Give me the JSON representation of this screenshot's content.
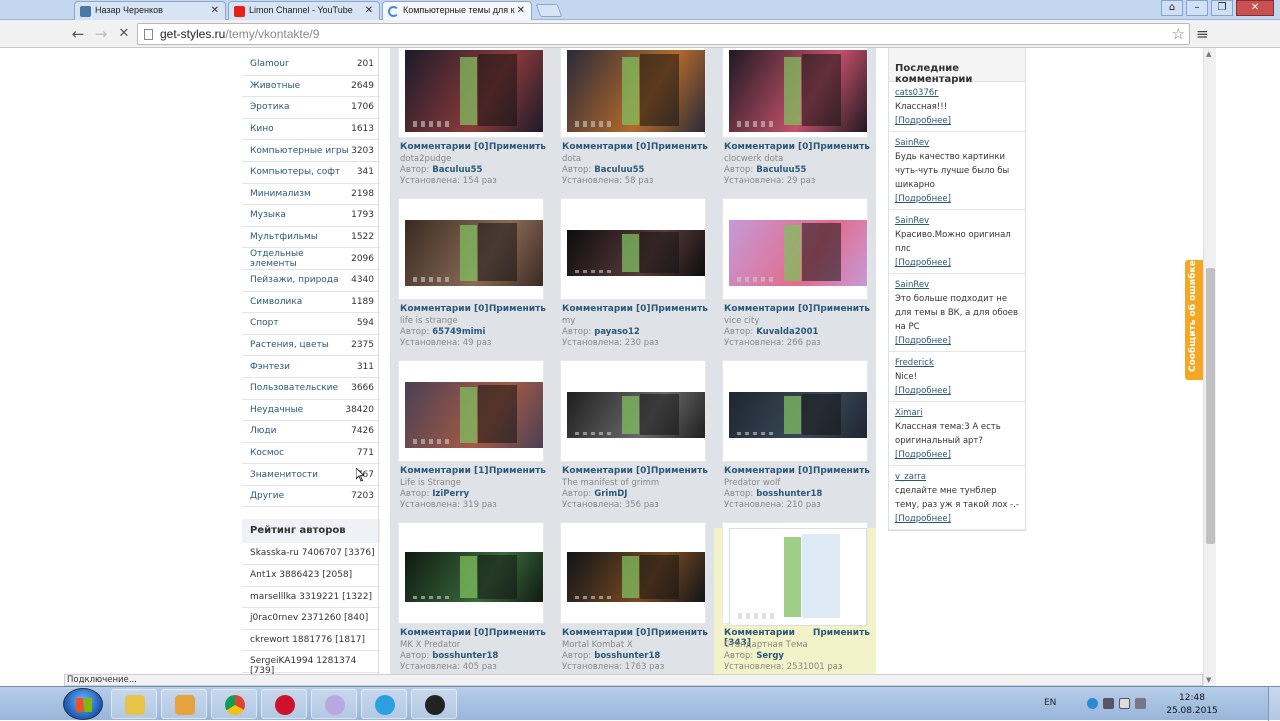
{
  "browser": {
    "tabs": [
      {
        "title": "Назар Черенков",
        "icon": "vk-icon"
      },
      {
        "title": "Limon Channel - YouTube",
        "icon": "youtube-icon"
      },
      {
        "title": "Компьютерные темы для к",
        "icon": "loading-icon"
      }
    ],
    "url_host": "get-styles.ru",
    "url_path": "/temy/vkontakte/9",
    "status": "Подключение..."
  },
  "categories": [
    {
      "name": "Glamour",
      "count": "201"
    },
    {
      "name": "Животные",
      "count": "2649"
    },
    {
      "name": "Эротика",
      "count": "1706"
    },
    {
      "name": "Кино",
      "count": "1613"
    },
    {
      "name": "Компьютерные игры",
      "count": "3203"
    },
    {
      "name": "Компьютеры, софт",
      "count": "341"
    },
    {
      "name": "Минимализм",
      "count": "2198"
    },
    {
      "name": "Музыка",
      "count": "1793"
    },
    {
      "name": "Мультфильмы",
      "count": "1522"
    },
    {
      "name": "Отдельные элементы",
      "count": "2096"
    },
    {
      "name": "Пейзажи, природа",
      "count": "4340"
    },
    {
      "name": "Символика",
      "count": "1189"
    },
    {
      "name": "Спорт",
      "count": "594"
    },
    {
      "name": "Растения, цветы",
      "count": "2375"
    },
    {
      "name": "Фэнтези",
      "count": "311"
    },
    {
      "name": "Пользовательские",
      "count": "3666"
    },
    {
      "name": "Неудачные",
      "count": "38420"
    },
    {
      "name": "Люди",
      "count": "7426"
    },
    {
      "name": "Космос",
      "count": "771"
    },
    {
      "name": "Знаменитости",
      "count": "767"
    },
    {
      "name": "Другие",
      "count": "7203"
    }
  ],
  "rating": {
    "title": "Рейтинг авторов",
    "rows": [
      "Skasska-ru 7406707 [3376]",
      "Ant1x 3886423 [2058]",
      "marselllka 3319221 [1322]",
      "j0rac0rnev 2371260 [840]",
      "ckrewort 1881776 [1817]",
      "SergeiKA1994 1281374 [739]"
    ]
  },
  "themes": [
    {
      "comments": "Комментарии [0]",
      "apply": "Применить",
      "title": "dota2pudge",
      "author_label": "Автор:",
      "author": "Baculuu55",
      "installed": "Установлена: 154 раз",
      "palette": [
        "#1b1b2a",
        "#8c3a3a"
      ]
    },
    {
      "comments": "Комментарии [0]",
      "apply": "Применить",
      "title": "dota",
      "author_label": "Автор:",
      "author": "Baculuu55",
      "installed": "Установлена: 58 раз",
      "palette": [
        "#2a2a3a",
        "#b36a2a"
      ]
    },
    {
      "comments": "Комментарии [0]",
      "apply": "Применить",
      "title": "clocwerk dota",
      "author_label": "Автор:",
      "author": "Baculuu55",
      "installed": "Установлена: 29 раз",
      "palette": [
        "#1d1a22",
        "#c5506a"
      ]
    },
    {
      "comments": "Комментарии [0]",
      "apply": "Применить",
      "title": "life is strange",
      "author_label": "Автор:",
      "author": "65749mimi",
      "installed": "Установлена: 49 раз",
      "palette": [
        "#3a2a22",
        "#8a6a55"
      ]
    },
    {
      "comments": "Комментарии [0]",
      "apply": "Применить",
      "title": "my",
      "author_label": "Автор:",
      "author": "payaso12",
      "installed": "Установлена: 230 раз",
      "palette": [
        "#0d0d0d",
        "#5a3a3a"
      ]
    },
    {
      "comments": "Комментарии [0]",
      "apply": "Применить",
      "title": "vice city",
      "author_label": "Автор:",
      "author": "Kuvalda2001",
      "installed": "Установлена: 266 раз",
      "palette": [
        "#c49ad8",
        "#e46a8a"
      ]
    },
    {
      "comments": "Комментарии [1]",
      "apply": "Применить",
      "title": "Life is Strange",
      "author_label": "Автор:",
      "author": "IziPerry",
      "installed": "Установлена: 319 раз",
      "palette": [
        "#4a4055",
        "#a55a45"
      ]
    },
    {
      "comments": "Комментарии [0]",
      "apply": "Применить",
      "title": "The manifest of grimm",
      "author_label": "Автор:",
      "author": "GrimDJ",
      "installed": "Установлена: 356 раз",
      "palette": [
        "#1f1f1f",
        "#6a6a6a"
      ]
    },
    {
      "comments": "Комментарии [0]",
      "apply": "Применить",
      "title": "Predator wolf",
      "author_label": "Автор:",
      "author": "bosshunter18",
      "installed": "Установлена: 210 раз",
      "palette": [
        "#1e2630",
        "#3a4a5a"
      ]
    },
    {
      "comments": "Комментарии [0]",
      "apply": "Применить",
      "title": "MK X Predator",
      "author_label": "Автор:",
      "author": "bosshunter18",
      "installed": "Установлена: 405 раз",
      "palette": [
        "#0f1a12",
        "#3a6a3a"
      ]
    },
    {
      "comments": "Комментарии [0]",
      "apply": "Применить",
      "title": "Mortal Kombat X",
      "author_label": "Автор:",
      "author": "bosshunter18",
      "installed": "Установлена: 1763 раз",
      "palette": [
        "#101418",
        "#7a4a22"
      ]
    },
    {
      "comments": "Комментарии [343]",
      "apply": "Применить",
      "title": "Стандартная Тема",
      "author_label": "Автор:",
      "author": "Sergy",
      "installed": "Установлена: 2531001 раз",
      "palette": [
        "#ffffff",
        "#7ab34a"
      ]
    }
  ],
  "comments_panel": {
    "title": "Последние комментарии",
    "items": [
      {
        "user": "cats0376г",
        "text": "Классная!!!",
        "more": "[Подробнее]"
      },
      {
        "user": "SainRev",
        "text": "Будь качество картинки чуть-чуть лучше было бы шикарно",
        "more": "[Подробнее]"
      },
      {
        "user": "SainRev",
        "text": "Красиво.Можно оригинал плс",
        "more": "[Подробнее]"
      },
      {
        "user": "SainRev",
        "text": "Это больше подходит не для темы в ВК, а для обоев на PC",
        "more": "[Подробнее]"
      },
      {
        "user": "Frederick",
        "text": "Nice!",
        "more": "[Подробнее]"
      },
      {
        "user": "Ximari",
        "text": "Классная тема:3 А есть оригинальный арт?",
        "more": "[Подробнее]"
      },
      {
        "user": "v_zarra",
        "text": "сделайте мне тунблер тему, раз уж я такой лох -.-",
        "more": "[Подробнее]"
      }
    ]
  },
  "feedback_label": "Сообщить об ошибке",
  "taskbar": {
    "lang": "EN",
    "time": "12:48",
    "date": "25.08.2015",
    "apps": [
      "explorer-icon",
      "media-player-icon",
      "chrome-icon",
      "opera-icon",
      "spider-icon",
      "skype-icon",
      "obs-icon"
    ]
  }
}
